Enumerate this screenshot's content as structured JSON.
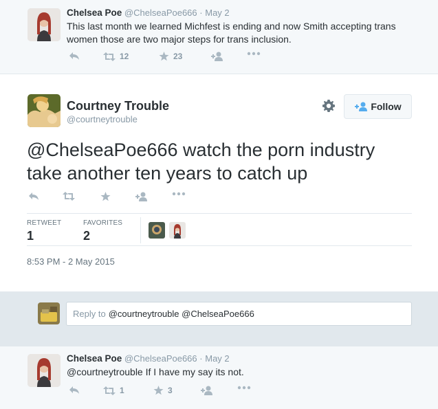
{
  "tweet1": {
    "name": "Chelsea Poe",
    "handle": "@ChelseaPoe666",
    "separator": "·",
    "date": "May 2",
    "text": "This last month we learned Michfest is ending and now Smith accepting trans women those are two major steps for trans inclusion.",
    "retweets": "12",
    "favorites": "23"
  },
  "main": {
    "name": "Courtney Trouble",
    "handle": "@courtneytrouble",
    "follow_label": "Follow",
    "text": "@ChelseaPoe666 watch the porn industry take another ten years to catch up",
    "retweet_label": "RETWEET",
    "retweet_count": "1",
    "favorites_label": "FAVORITES",
    "favorites_count": "2",
    "timestamp": "8:53 PM - 2 May 2015"
  },
  "reply": {
    "prefix": "Reply to",
    "mentions": "@courtneytrouble @ChelseaPoe666"
  },
  "tweet2": {
    "name": "Chelsea Poe",
    "handle": "@ChelseaPoe666",
    "separator": "·",
    "date": "May 2",
    "text": "@courtneytrouble If I have my say its not.",
    "retweets": "1",
    "favorites": "3"
  },
  "colors": {
    "icon_gray": "#aab8c2",
    "text_dark": "#292f33",
    "text_muted": "#8899a6",
    "panel_bg": "#f5f8fa",
    "reply_bar_bg": "#e1e8ed"
  },
  "icons": [
    "reply-icon",
    "retweet-icon",
    "favorite-star-icon",
    "follow-user-icon",
    "more-icon",
    "gear-icon"
  ]
}
